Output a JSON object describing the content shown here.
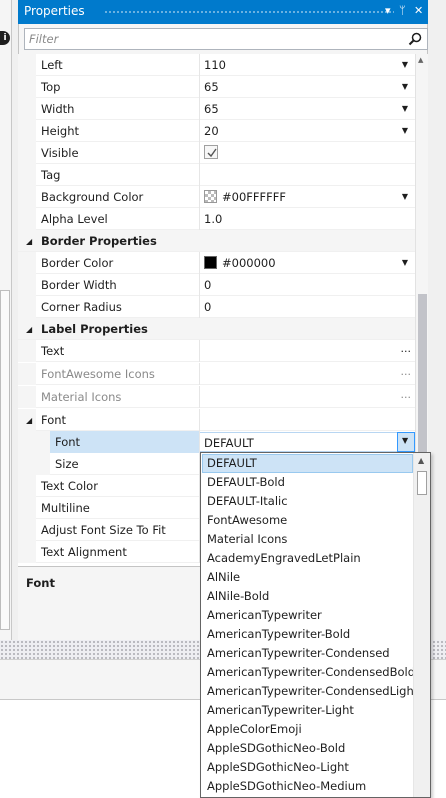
{
  "left_info_icon": "info-icon",
  "window": {
    "title": "Properties",
    "controls": [
      "▾",
      "ᛘ",
      "✕"
    ]
  },
  "filter": {
    "placeholder": "Filter",
    "icon": "search-icon"
  },
  "properties": {
    "left": {
      "label": "Left",
      "value": "110"
    },
    "top": {
      "label": "Top",
      "value": "65"
    },
    "width": {
      "label": "Width",
      "value": "65"
    },
    "height": {
      "label": "Height",
      "value": "20"
    },
    "visible": {
      "label": "Visible",
      "checked": true
    },
    "tag": {
      "label": "Tag",
      "value": ""
    },
    "background_color": {
      "label": "Background Color",
      "value": "#00FFFFFF"
    },
    "alpha_level": {
      "label": "Alpha Level",
      "value": "1.0"
    },
    "border_category": "Border Properties",
    "border_color": {
      "label": "Border Color",
      "value": "#000000",
      "swatch": "#000000"
    },
    "border_width": {
      "label": "Border Width",
      "value": "0"
    },
    "corner_radius": {
      "label": "Corner Radius",
      "value": "0"
    },
    "label_category": "Label Properties",
    "text": {
      "label": "Text",
      "value": "",
      "ellipsis": "..."
    },
    "fontawesome_icons": {
      "label": "FontAwesome Icons",
      "ellipsis": "..."
    },
    "material_icons": {
      "label": "Material Icons",
      "ellipsis": "..."
    },
    "font": {
      "label": "Font"
    },
    "font_font": {
      "label": "Font",
      "value": "DEFAULT"
    },
    "font_size": {
      "label": "Size"
    },
    "text_color": {
      "label": "Text Color"
    },
    "multiline": {
      "label": "Multiline"
    },
    "adjust_font_size": {
      "label": "Adjust Font Size To Fit"
    },
    "text_alignment": {
      "label": "Text Alignment"
    }
  },
  "description": {
    "title": "Font"
  },
  "font_dropdown": {
    "selected": "DEFAULT",
    "options": [
      "DEFAULT",
      "DEFAULT-Bold",
      "DEFAULT-Italic",
      "FontAwesome",
      "Material Icons",
      "AcademyEngravedLetPlain",
      "AlNile",
      "AlNile-Bold",
      "AmericanTypewriter",
      "AmericanTypewriter-Bold",
      "AmericanTypewriter-Condensed",
      "AmericanTypewriter-CondensedBold",
      "AmericanTypewriter-CondensedLight",
      "AmericanTypewriter-Light",
      "AppleColorEmoji",
      "AppleSDGothicNeo-Bold",
      "AppleSDGothicNeo-Light",
      "AppleSDGothicNeo-Medium"
    ]
  }
}
